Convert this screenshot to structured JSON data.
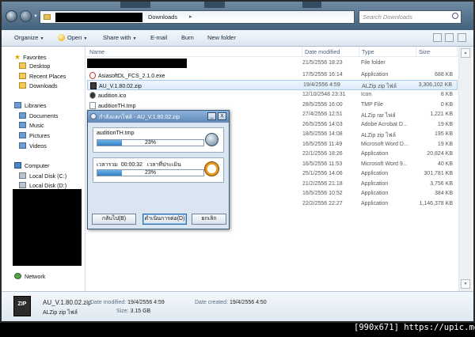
{
  "address": {
    "folder": "Downloads",
    "search_placeholder": "Search Downloads"
  },
  "toolbar": {
    "organize": "Organize",
    "open": "Open",
    "share_with": "Share with",
    "email": "E-mail",
    "burn": "Burn",
    "new_folder": "New folder"
  },
  "nav": {
    "favorites": "Favorites",
    "desktop": "Desktop",
    "recent_places": "Recent Places",
    "downloads": "Downloads",
    "libraries": "Libraries",
    "documents": "Documents",
    "music": "Music",
    "pictures": "Pictures",
    "videos": "Videos",
    "computer": "Computer",
    "local_c": "Local Disk (C:)",
    "local_d": "Local Disk (D:)",
    "network": "Network"
  },
  "columns": {
    "name": "Name",
    "date_modified": "Date modified",
    "type": "Type",
    "size": "Size"
  },
  "rows": [
    {
      "name": "",
      "date": "21/5/2556 18:23",
      "type": "File folder",
      "size": "",
      "redacted": true
    },
    {
      "name": "AsiasoftDL_FCS_2.1.0.exe",
      "date": "17/5/2556 16:14",
      "type": "Application",
      "size": "688 KB",
      "icon": "exe"
    },
    {
      "name": "AU_V.1.80.02.zip",
      "date": "19/4/2556 4:59",
      "type": "ALZip zip ไฟล์",
      "size": "3,306,102 KB",
      "icon": "zip",
      "selected": true
    },
    {
      "name": "audition.ico",
      "date": "12/10/2548 23:31",
      "type": "Icon",
      "size": "8 KB",
      "icon": "ico"
    },
    {
      "name": "auditionTH.tmp",
      "date": "28/5/2556 16:00",
      "type": "TMP File",
      "size": "0 KB",
      "icon": "file"
    },
    {
      "name": "",
      "date": "27/4/2556 12:51",
      "type": "ALZip rar ไฟล์",
      "size": "1,221 KB"
    },
    {
      "name": "",
      "date": "26/5/2556 14:03",
      "type": "Adobe Acrobat D...",
      "size": "19 KB"
    },
    {
      "name": "",
      "date": "18/5/2556 14:08",
      "type": "ALZip zip ไฟล์",
      "size": "195 KB"
    },
    {
      "name": "",
      "date": "16/5/2556 11:49",
      "type": "Microsoft Word D...",
      "size": "19 KB"
    },
    {
      "name": "",
      "date": "22/1/2556 18:26",
      "type": "Application",
      "size": "20,824 KB"
    },
    {
      "name": "",
      "date": "16/5/2556 11:53",
      "type": "Microsoft Word 9...",
      "size": "40 KB"
    },
    {
      "name": "",
      "date": "25/1/2556 14:06",
      "type": "Application",
      "size": "301,781 KB"
    },
    {
      "name": "",
      "date": "21/2/2556 21:18",
      "type": "Application",
      "size": "3,756 KB"
    },
    {
      "name": "",
      "date": "16/5/2556 10:52",
      "type": "Application",
      "size": "384 KB"
    },
    {
      "name": "",
      "date": "22/2/2556 22:27",
      "type": "Application",
      "size": "1,146,378 KB"
    }
  ],
  "details": {
    "filename": "AU_V.1.80.02.zip",
    "filetype": "ALZip zip ไฟล์",
    "modified_label": "Date modified:",
    "modified_value": "19/4/2556 4:59",
    "created_label": "Date created:",
    "created_value": "19/4/2556 4:50",
    "size_label": "Size:",
    "size_value": "3.15 GB",
    "zip_badge": "ZIP"
  },
  "dialog": {
    "title": "กำลังแตกไฟล์ - AU_V.1.80.02.zip",
    "min": "_",
    "close": "x",
    "file_label": "auditionTH.tmp",
    "file_percent": "23%",
    "file_progress": 0.23,
    "elapsed_label": "เวลารวม",
    "elapsed_value": "00:00:32",
    "remaining_label": "เวลาที่ประเมิน",
    "total_percent": "23%",
    "total_progress": 0.23,
    "btn_back": "กลับไป(B)",
    "btn_continue": "ดำเนินการต่อ(D)",
    "btn_cancel": "ยกเลิก"
  },
  "footer": "[990x671] https://upic.me/"
}
